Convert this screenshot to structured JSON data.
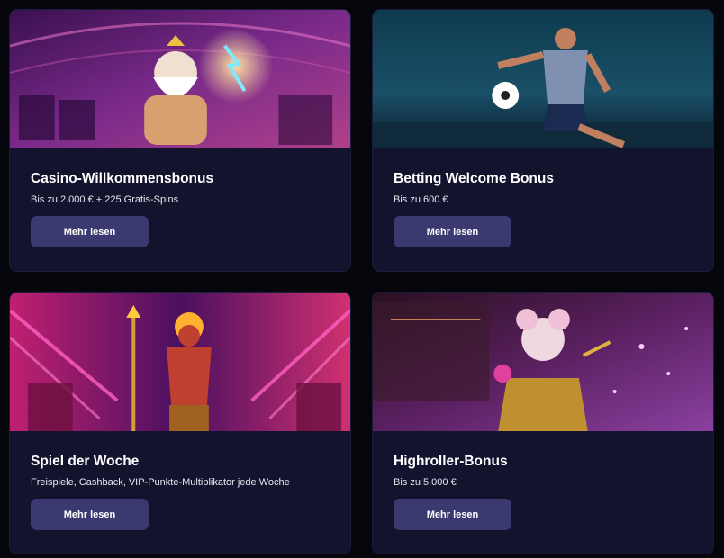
{
  "cards": [
    {
      "title": "Casino-Willkommensbonus",
      "subtitle": "Bis zu 2.000 € + 225 Gratis-Spins",
      "button": "Mehr lesen",
      "image_icon": "zeus-casino-art"
    },
    {
      "title": "Betting Welcome Bonus",
      "subtitle": "Bis zu 600 €",
      "button": "Mehr lesen",
      "image_icon": "football-player-art"
    },
    {
      "title": "Spiel der Woche",
      "subtitle": "Freispiele, Cashback, VIP-Punkte-Multiplikator jede Woche",
      "button": "Mehr lesen",
      "image_icon": "fire-warrior-art"
    },
    {
      "title": "Highroller-Bonus",
      "subtitle": "Bis zu 5.000 €",
      "button": "Mehr lesen",
      "image_icon": "joker-girl-art"
    }
  ],
  "colors": {
    "page_bg": "#05060c",
    "card_bg": "#13132e",
    "button_bg": "#3a3a70",
    "text": "#ffffff"
  }
}
